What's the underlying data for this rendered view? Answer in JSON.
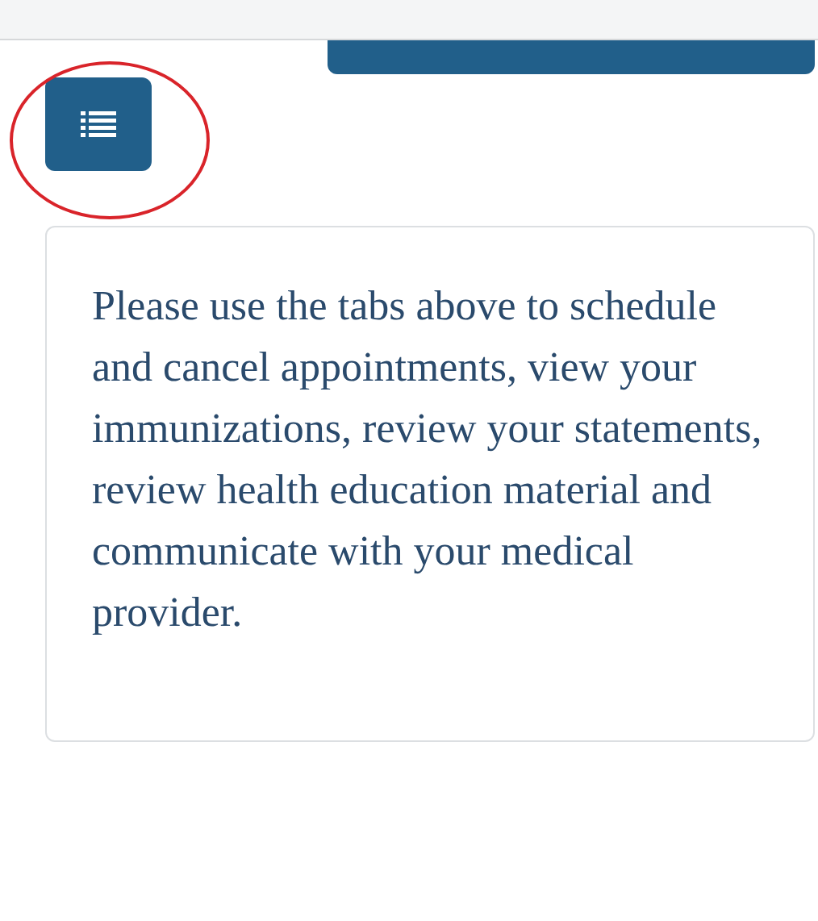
{
  "message": "Please use the tabs above to schedule and cancel appointments, view your immunizations, review your statements, review health education material and communicate with your medical provider."
}
